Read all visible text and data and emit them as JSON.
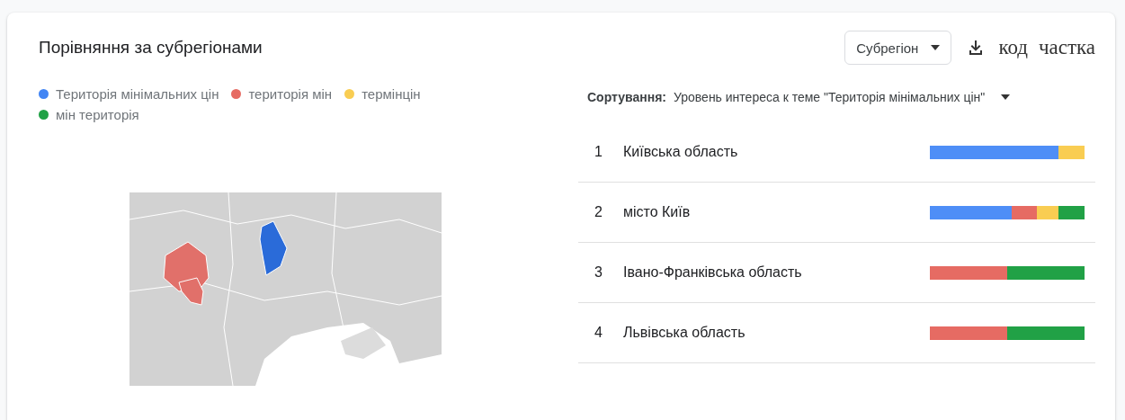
{
  "title": "Порівняння за субрегіонами",
  "region_select": {
    "value": "Субрегіон"
  },
  "header_links": [
    "код",
    "частка"
  ],
  "legend": [
    {
      "label": "Територія мінімальних цін",
      "color": "#4285f4"
    },
    {
      "label": "територія мін",
      "color": "#e66b63"
    },
    {
      "label": "термінцін",
      "color": "#f9cd52"
    },
    {
      "label": "мін територія",
      "color": "#21a146"
    }
  ],
  "sort": {
    "label": "Сортування:",
    "value": "Уровень интереса к теме \"Територія мінімальних цін\""
  },
  "rows": [
    {
      "rank": "1",
      "name": "Київська область",
      "segments": [
        {
          "color": "#4e8ef7"
        },
        {
          "color": "#f9cd52"
        }
      ]
    },
    {
      "rank": "2",
      "name": "місто Київ",
      "segments": [
        {
          "color": "#4e8ef7"
        },
        {
          "color": "#e66b63"
        },
        {
          "color": "#f9cd52"
        },
        {
          "color": "#21a146"
        }
      ]
    },
    {
      "rank": "3",
      "name": "Івано-Франківська область",
      "segments": [
        {
          "color": "#e66b63"
        },
        {
          "color": "#21a146"
        }
      ]
    },
    {
      "rank": "4",
      "name": "Львівська область",
      "segments": [
        {
          "color": "#e66b63"
        },
        {
          "color": "#21a146"
        }
      ]
    }
  ]
}
